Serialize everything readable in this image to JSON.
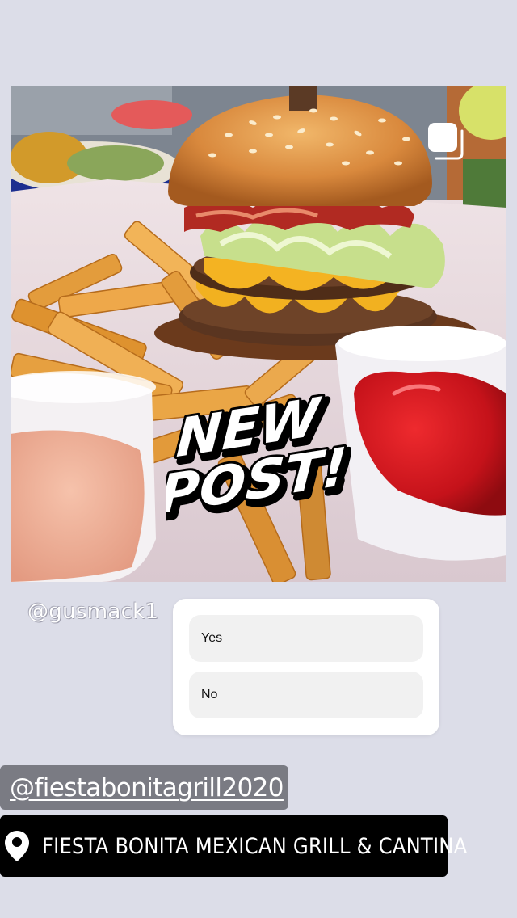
{
  "post": {
    "photo_icon": "burger-and-fries-photo",
    "gallery_icon": "gallery-icon",
    "sticker": {
      "line1": "NEW",
      "line2": "POST!"
    }
  },
  "mention": {
    "handle": "@gusmack1"
  },
  "poll": {
    "options": [
      {
        "label": "Yes"
      },
      {
        "label": "No"
      }
    ]
  },
  "tags": {
    "account_handle": "@fiestabonitagrill2020",
    "location_icon": "location-pin-icon",
    "location_name": "FIESTA BONITA MEXICAN GRILL & CANTINA"
  },
  "colors": {
    "background": "#dcdde8",
    "poll_card": "#ffffff",
    "poll_option": "#f1f1f1",
    "location_pill": "#000000",
    "ketchup": "#d4141c",
    "fries": "#e7a140"
  }
}
